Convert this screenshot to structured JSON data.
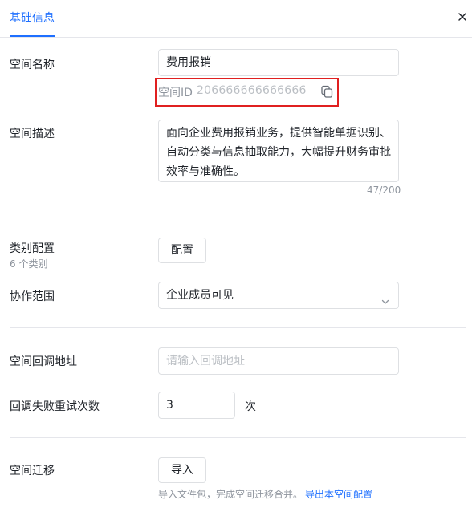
{
  "header": {
    "tab_label": "基础信息"
  },
  "name": {
    "label": "空间名称",
    "value": "费用报销"
  },
  "space_id": {
    "label": "空间ID",
    "value": "206666666666666"
  },
  "description": {
    "label": "空间描述",
    "value": "面向企业费用报销业务，提供智能单据识别、自动分类与信息抽取能力，大幅提升财务审批效率与准确性。",
    "counter": "47/200"
  },
  "category": {
    "label": "类别配置",
    "sublabel": "6 个类别",
    "button_label": "配置"
  },
  "scope": {
    "label": "协作范围",
    "selected": "企业成员可见"
  },
  "callback": {
    "label": "空间回调地址",
    "placeholder": "请输入回调地址"
  },
  "retry": {
    "label": "回调失败重试次数",
    "value": "3",
    "unit": "次"
  },
  "migration": {
    "label": "空间迁移",
    "button_label": "导入",
    "hint": "导入文件包，完成空间迁移合并。",
    "link": "导出本空间配置"
  },
  "colors": {
    "accent": "#1e6fff",
    "highlight_border": "#e02020"
  },
  "icons": {
    "close": "close-icon",
    "copy": "copy-icon",
    "dropdown": "chevron-down-icon"
  }
}
